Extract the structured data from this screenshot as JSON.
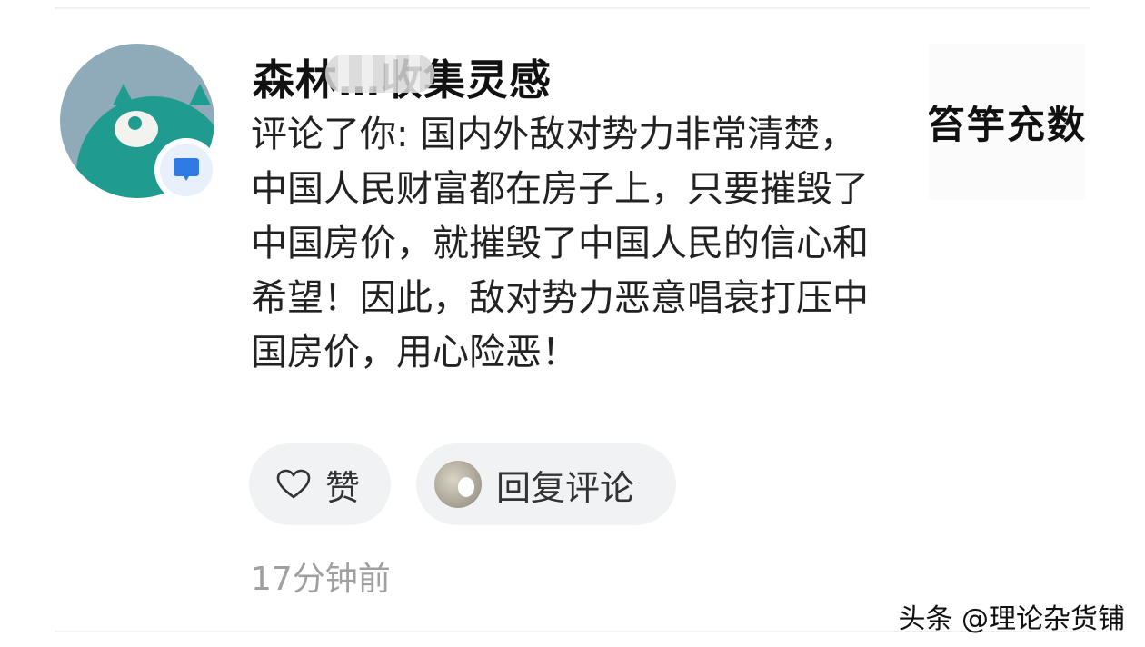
{
  "comment": {
    "username": "森林…收集灵感",
    "text": "评论了你: 国内外敌对势力非常清楚，中国人民财富都在房子上，只要摧毁了中国房价，就摧毁了中国人民的信心和希望！因此，敌对势力恶意唱衰打压中国房价，用心险恶！",
    "timestamp": "17分钟前"
  },
  "avatar": {
    "icon": "teal-monster-avatar",
    "background_color": "#8faab9",
    "accent_color": "#1f9c8f"
  },
  "badge": {
    "icon": "comment-bubble-icon",
    "color": "#2f7ae5"
  },
  "thumbnail": {
    "text": "笞竽充数"
  },
  "actions": {
    "like_label": "赞",
    "like_icon": "heart-outline-icon",
    "reply_label": "回复评论"
  },
  "watermark": "头条 @理论杂货铺"
}
